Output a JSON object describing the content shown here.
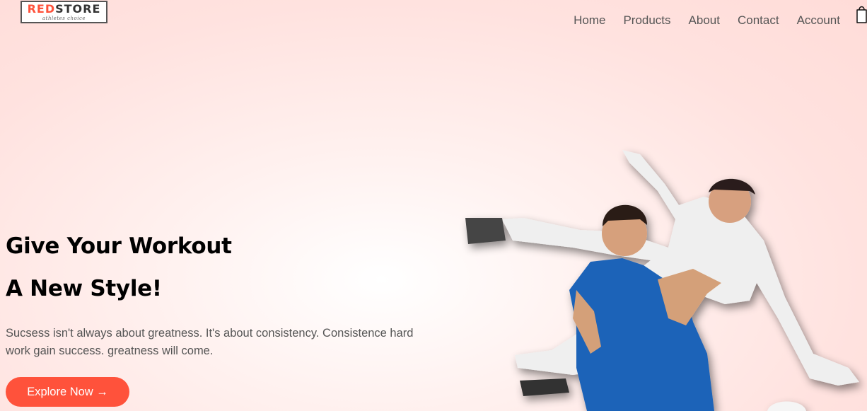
{
  "brand": {
    "logo_red": "RED",
    "logo_rest": "STORE",
    "tagline": "athletes choice"
  },
  "nav": {
    "items": [
      "Home",
      "Products",
      "About",
      "Contact",
      "Account"
    ],
    "cart_icon": "shopping-bag-icon"
  },
  "hero": {
    "heading_line1": "Give Your Workout",
    "heading_line2": "A New Style!",
    "description": "Sucsess isn't always about greatness. It's about consistency. Consistence hard work gain success. greatness will come.",
    "cta_label": "Explore Now →",
    "image_alt": "two-football-players-celebrating"
  },
  "colors": {
    "accent": "#ff523b",
    "text_dark": "#000000",
    "text_muted": "#555555",
    "background": "#ffe2df"
  }
}
